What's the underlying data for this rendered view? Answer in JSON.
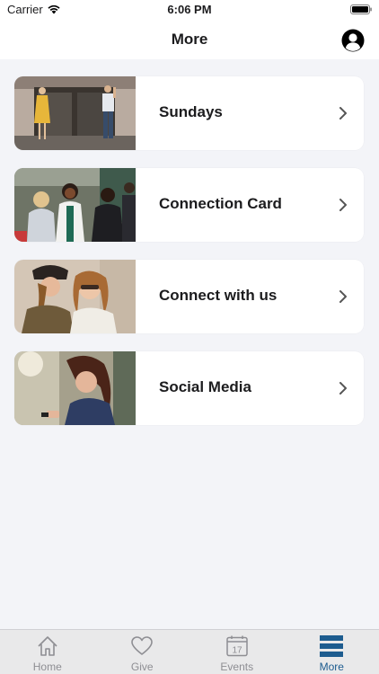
{
  "status_bar": {
    "carrier": "Carrier",
    "time": "6:06 PM"
  },
  "nav": {
    "title": "More",
    "profile_icon": "person-circle-icon"
  },
  "menu": [
    {
      "label": "Sundays",
      "thumb": "church-entrance-photo"
    },
    {
      "label": "Connection Card",
      "thumb": "people-chatting-photo"
    },
    {
      "label": "Connect with us",
      "thumb": "friends-hugging-photo"
    },
    {
      "label": "Social Media",
      "thumb": "woman-phone-photo"
    }
  ],
  "tabs": [
    {
      "label": "Home",
      "icon": "house-icon",
      "active": false
    },
    {
      "label": "Give",
      "icon": "heart-icon",
      "active": false
    },
    {
      "label": "Events",
      "icon": "calendar-icon",
      "active": false,
      "calendar_day": "17"
    },
    {
      "label": "More",
      "icon": "menu-lines-icon",
      "active": true
    }
  ],
  "colors": {
    "active_tab": "#1d5c8f",
    "inactive_tab": "#8e8e93",
    "background": "#f3f4f8"
  }
}
